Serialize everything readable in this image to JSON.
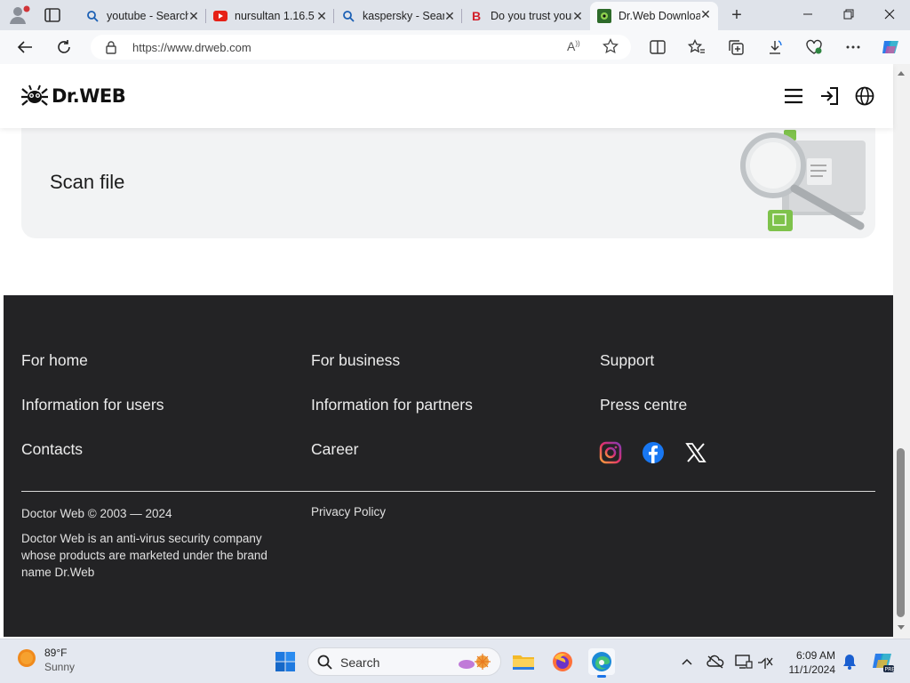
{
  "browser": {
    "tabs": [
      {
        "title": "youtube - Search",
        "icon": "search-icon"
      },
      {
        "title": "nursultan 1.16.5",
        "icon": "youtube-icon"
      },
      {
        "title": "kaspersky - Search",
        "icon": "search-icon"
      },
      {
        "title": "Do you trust your",
        "icon": "b-logo-icon"
      },
      {
        "title": "Dr.Web Downloads",
        "icon": "drweb-icon",
        "active": true
      }
    ],
    "url": "https://www.drweb.com"
  },
  "site": {
    "logo_text": "Dr.WEB",
    "scan_title": "Scan file"
  },
  "footer": {
    "col1": [
      "For home",
      "Information for users",
      "Contacts"
    ],
    "col2": [
      "For business",
      "Information for partners",
      "Career"
    ],
    "col3": [
      "Support",
      "Press centre"
    ],
    "social": [
      "instagram-icon",
      "facebook-icon",
      "x-icon"
    ],
    "copyright": "Doctor Web © 2003 — 2024",
    "about": "Doctor Web is an anti-virus security company whose products are marketed under the brand name Dr.Web",
    "privacy": "Privacy Policy"
  },
  "taskbar": {
    "weather_temp": "89°F",
    "weather_desc": "Sunny",
    "search_label": "Search",
    "time": "6:09 AM",
    "date": "11/1/2024"
  },
  "colors": {
    "footer_bg": "#232325",
    "card_bg": "#f2f3f4",
    "accent_green": "#7ec24b"
  }
}
